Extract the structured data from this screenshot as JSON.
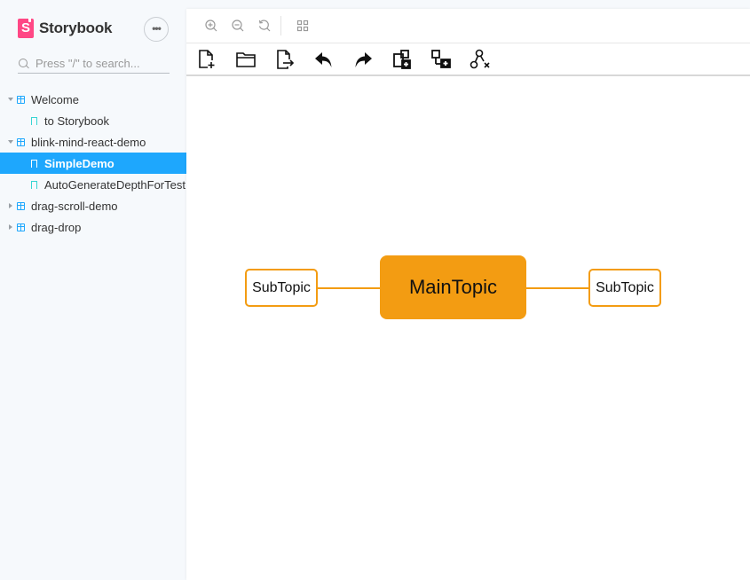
{
  "sidebar": {
    "brand": {
      "logo_letter": "S",
      "name": "Storybook"
    },
    "more_button": {
      "label": "•••",
      "icon": "ellipsis-icon"
    },
    "search": {
      "placeholder": "Press \"/\" to search...",
      "value": ""
    },
    "tree": [
      {
        "type": "group",
        "label": "Welcome",
        "expanded": true
      },
      {
        "type": "story",
        "label": "to Storybook",
        "selected": false
      },
      {
        "type": "group",
        "label": "blink-mind-react-demo",
        "expanded": true
      },
      {
        "type": "story",
        "label": "SimpleDemo",
        "selected": true
      },
      {
        "type": "story",
        "label": "AutoGenerateDepthForTest",
        "selected": false
      },
      {
        "type": "group",
        "label": "drag-scroll-demo",
        "expanded": false
      },
      {
        "type": "group",
        "label": "drag-drop",
        "expanded": false
      }
    ]
  },
  "storybook_toolbar": {
    "tools": [
      {
        "name": "zoom-in",
        "icon": "zoom-in-icon"
      },
      {
        "name": "zoom-out",
        "icon": "zoom-out-icon"
      },
      {
        "name": "reset-zoom",
        "icon": "reset-zoom-icon"
      },
      {
        "name": "grid",
        "icon": "grid-icon"
      }
    ]
  },
  "mindmap_toolbar": {
    "tools": [
      {
        "name": "new-file",
        "icon": "new-file-icon"
      },
      {
        "name": "open-file",
        "icon": "folder-open-icon"
      },
      {
        "name": "export",
        "icon": "export-icon"
      },
      {
        "name": "undo",
        "icon": "undo-icon"
      },
      {
        "name": "redo",
        "icon": "redo-icon"
      },
      {
        "name": "add-child",
        "icon": "add-child-icon"
      },
      {
        "name": "add-sibling",
        "icon": "add-sibling-icon"
      },
      {
        "name": "delete-node",
        "icon": "delete-node-icon"
      }
    ]
  },
  "mindmap": {
    "colors": {
      "accent": "#f39c12",
      "text": "#111111"
    },
    "main_topic": "MainTopic",
    "sub_topics": [
      "SubTopic",
      "SubTopic"
    ]
  },
  "colors": {
    "selected_bg": "#1ea7fd",
    "brand": "#ff4785",
    "story_icon": "#37d5d3"
  }
}
